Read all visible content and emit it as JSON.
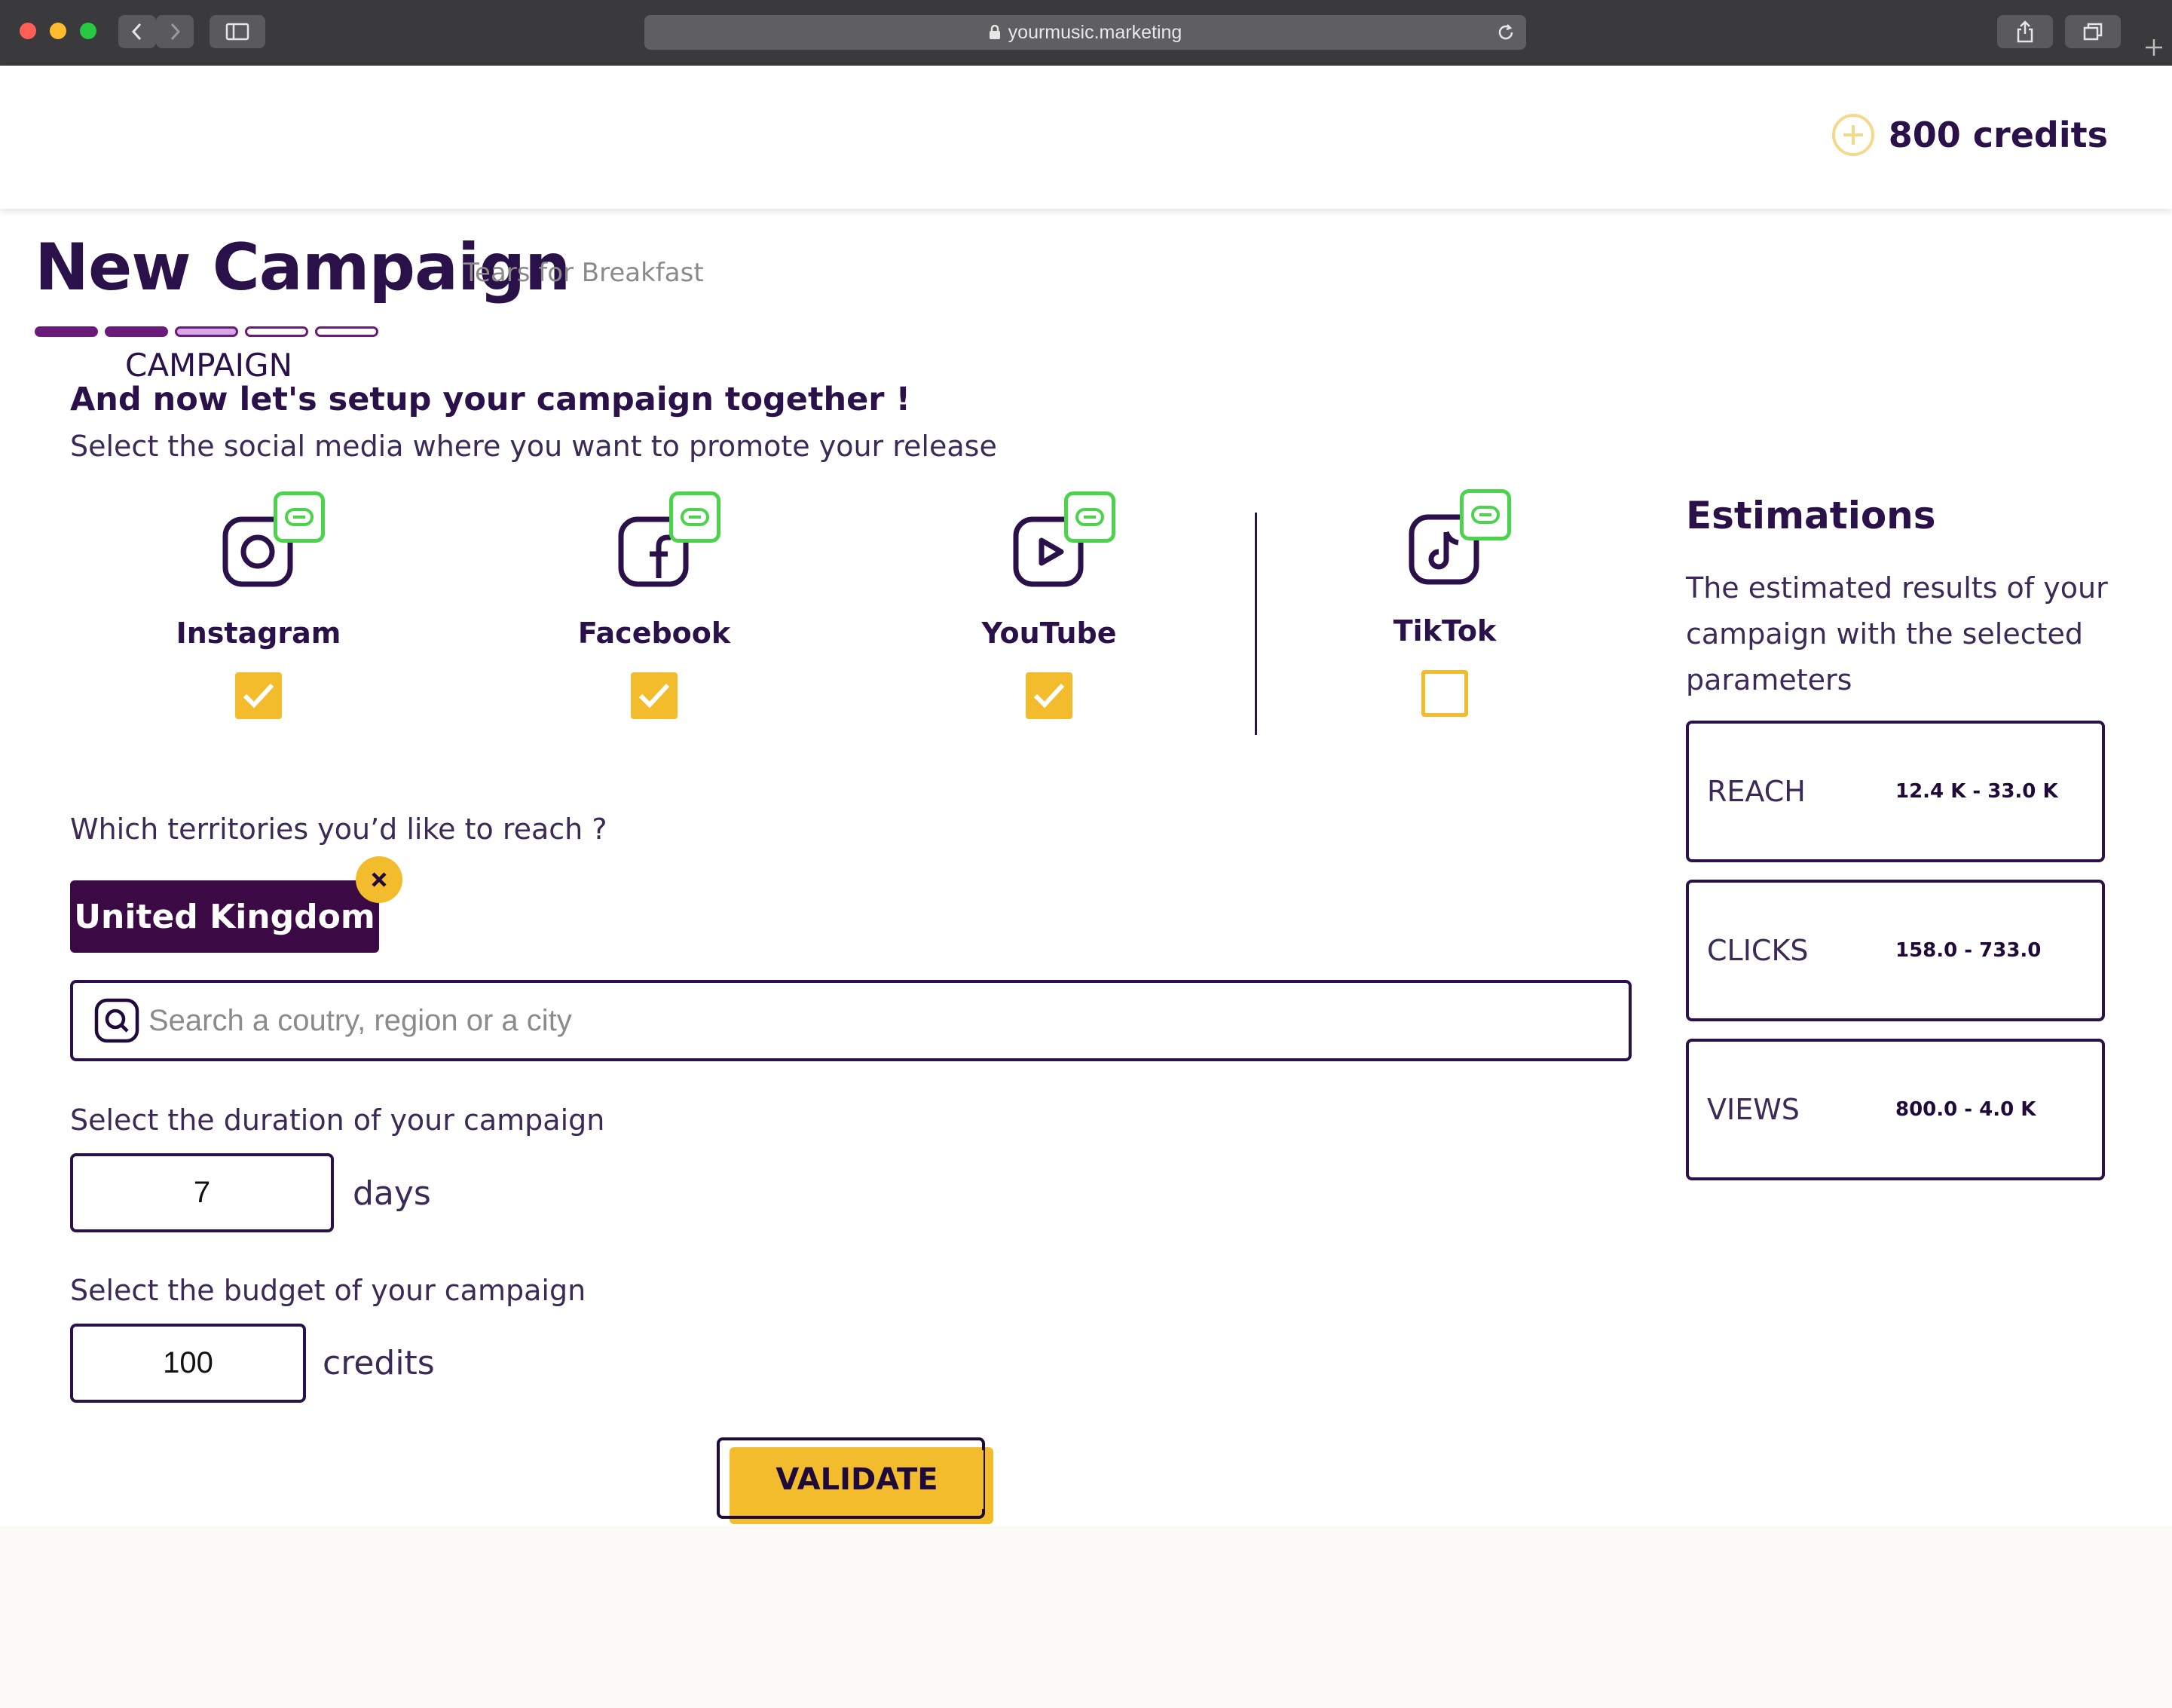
{
  "browser": {
    "url": "yourmusic.marketing"
  },
  "header": {
    "credits": "800 credits"
  },
  "page": {
    "title": "New Campaign",
    "subtitle": "Tears for Breakfast",
    "step_label": "CAMPAIGN",
    "progress": {
      "total_steps": 5,
      "completed_steps": 2,
      "current_step": 3
    },
    "headline": "And now let's setup your campaign together !",
    "lead": "Select the social media where you want to promote your release"
  },
  "social": [
    {
      "name": "Instagram",
      "icon": "instagram-icon",
      "checked": true
    },
    {
      "name": "Facebook",
      "icon": "facebook-icon",
      "checked": true
    },
    {
      "name": "YouTube",
      "icon": "youtube-icon",
      "checked": true
    },
    {
      "name": "TikTok",
      "icon": "tiktok-icon",
      "checked": false
    }
  ],
  "territories": {
    "question": "Which territories you’d like to reach ?",
    "selected": [
      "United Kingdom"
    ],
    "search_placeholder": "Search a coutry, region or a city"
  },
  "duration": {
    "question": "Select the duration of your campaign",
    "value": "7",
    "unit": "days"
  },
  "budget": {
    "question": "Select the budget of your campaign",
    "value": "100",
    "unit": "credits"
  },
  "validate_label": "VALIDATE",
  "estimations": {
    "title": "Estimations",
    "description": "The estimated results of your campaign with the selected parameters",
    "metrics": [
      {
        "label": "REACH",
        "value": "12.4 K - 33.0 K"
      },
      {
        "label": "CLICKS",
        "value": "158.0 - 733.0"
      },
      {
        "label": "VIEWS",
        "value": "800.0 - 4.0 K"
      }
    ]
  },
  "colors": {
    "brand_dark": "#2b1149",
    "chip_bg": "#3b0a45",
    "accent_yellow": "#f3bc2d",
    "link_green": "#4cd34c",
    "progress_done": "#6a1b7a",
    "progress_current": "#d9a6e8"
  }
}
